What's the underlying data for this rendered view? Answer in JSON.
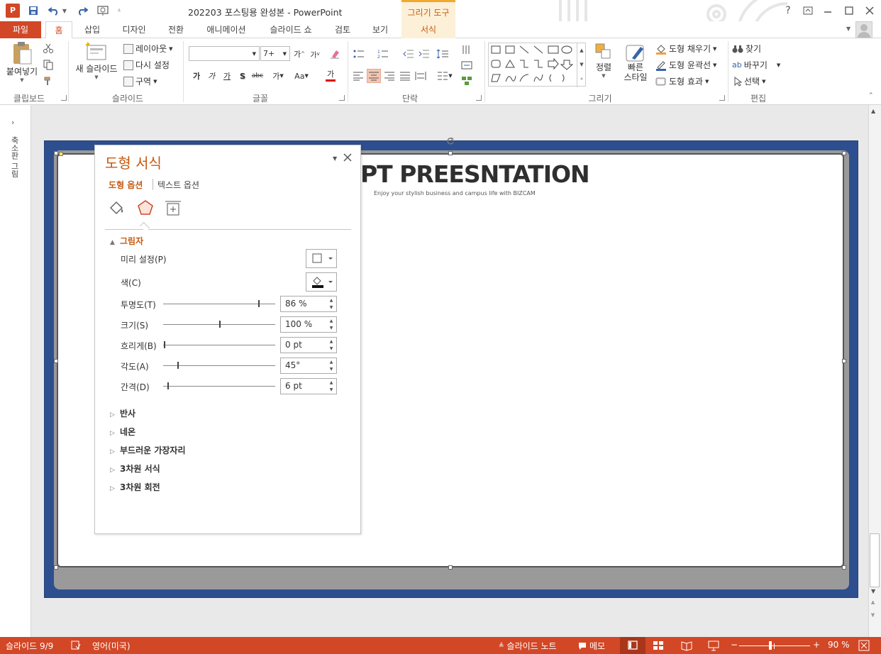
{
  "window": {
    "title": "202203 포스팅용 완성본 - PowerPoint",
    "contextual_tab": "그리기 도구",
    "help": "?"
  },
  "tabs": [
    "파일",
    "홈",
    "삽입",
    "디자인",
    "전환",
    "애니메이션",
    "슬라이드 쇼",
    "검토",
    "보기",
    "서식"
  ],
  "ribbon": {
    "clipboard": {
      "paste": "붙여넣기",
      "label": "클립보드"
    },
    "slides": {
      "new_slide": "새 슬라이드",
      "layout": "레이아웃",
      "reset": "다시 설정",
      "section": "구역",
      "label": "슬라이드"
    },
    "font": {
      "name": "",
      "size": "7+",
      "label": "글꼴",
      "bold": "가",
      "italic": "가",
      "underline": "가",
      "shadow": "S",
      "strike": "abc",
      "spacing": "가",
      "case": "Aa",
      "color": "가"
    },
    "paragraph": {
      "label": "단락"
    },
    "drawing": {
      "arrange": "정렬",
      "quick_styles_1": "빠른",
      "quick_styles_2": "스타일",
      "fill": "도형 채우기",
      "outline": "도형 윤곽선",
      "effects": "도형 효과",
      "label": "그리기"
    },
    "editing": {
      "find": "찾기",
      "replace": "바꾸기",
      "select": "선택",
      "label": "편집"
    }
  },
  "thumb_label": "축소판 그림",
  "slide": {
    "title": "PT PREESNTATION",
    "subtitle": "Enjoy your stylish business and campus life with BIZCAM"
  },
  "pane": {
    "title": "도형 서식",
    "tab_shape": "도형 옵션",
    "tab_text": "텍스트 옵션",
    "section_shadow": "그림자",
    "preset": "미리 설정(P)",
    "color": "색(C)",
    "rows": [
      {
        "label": "투명도(T)",
        "value": "86 %",
        "level": 0.86
      },
      {
        "label": "크기(S)",
        "value": "100 %",
        "level": 0.5
      },
      {
        "label": "흐리게(B)",
        "value": "0 pt",
        "level": 0.0
      },
      {
        "label": "각도(A)",
        "value": "45°",
        "level": 0.125
      },
      {
        "label": "간격(D)",
        "value": "6 pt",
        "level": 0.03
      }
    ],
    "sections": [
      "반사",
      "네온",
      "부드러운 가장자리",
      "3차원 서식",
      "3차원 회전"
    ]
  },
  "status": {
    "slide": "슬라이드 9/9",
    "language": "영어(미국)",
    "notes": "슬라이드 노트",
    "comments": "메모",
    "zoom": "90 %"
  },
  "colors": {
    "accent": "#d24726",
    "pane_title": "#c55a11",
    "slide_bg": "#2e4f8f"
  }
}
